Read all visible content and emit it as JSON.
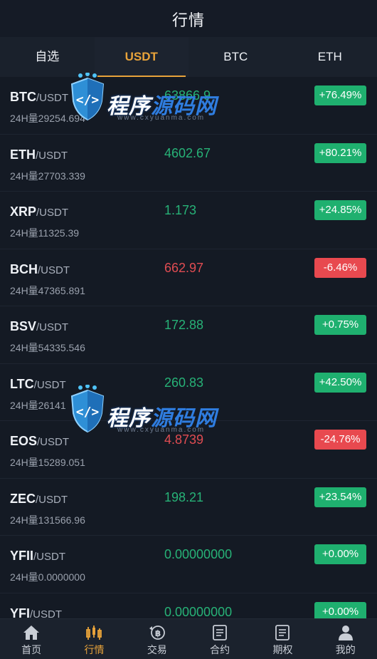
{
  "header": {
    "title": "行情"
  },
  "tabs": [
    {
      "label": "自选"
    },
    {
      "label": "USDT"
    },
    {
      "label": "BTC"
    },
    {
      "label": "ETH"
    }
  ],
  "colors": {
    "accent": "#e8a33a",
    "up": "#27b277",
    "down": "#e04c52",
    "background": "#141a24"
  },
  "markets": [
    {
      "base": "BTC",
      "quote": "/USDT",
      "volume": "24H量29254.694",
      "price": "63866.9",
      "change": "+76.49%",
      "dir": "up"
    },
    {
      "base": "ETH",
      "quote": "/USDT",
      "volume": "24H量27703.339",
      "price": "4602.67",
      "change": "+80.21%",
      "dir": "up"
    },
    {
      "base": "XRP",
      "quote": "/USDT",
      "volume": "24H量11325.39",
      "price": "1.173",
      "change": "+24.85%",
      "dir": "up"
    },
    {
      "base": "BCH",
      "quote": "/USDT",
      "volume": "24H量47365.891",
      "price": "662.97",
      "change": "-6.46%",
      "dir": "down"
    },
    {
      "base": "BSV",
      "quote": "/USDT",
      "volume": "24H量54335.546",
      "price": "172.88",
      "change": "+0.75%",
      "dir": "up"
    },
    {
      "base": "LTC",
      "quote": "/USDT",
      "volume": "24H量26141",
      "price": "260.83",
      "change": "+42.50%",
      "dir": "up"
    },
    {
      "base": "EOS",
      "quote": "/USDT",
      "volume": "24H量15289.051",
      "price": "4.8739",
      "change": "-24.76%",
      "dir": "down"
    },
    {
      "base": "ZEC",
      "quote": "/USDT",
      "volume": "24H量131566.96",
      "price": "198.21",
      "change": "+23.54%",
      "dir": "up"
    },
    {
      "base": "YFII",
      "quote": "/USDT",
      "volume": "24H量0.0000000",
      "price": "0.00000000",
      "change": "+0.00%",
      "dir": "up"
    },
    {
      "base": "YFI",
      "quote": "/USDT",
      "volume": "",
      "price": "0.00000000",
      "change": "+0.00%",
      "dir": "up"
    }
  ],
  "watermark": {
    "text_white": "程序",
    "text_blue": "源码网",
    "sub": "www.cxyuanma.com"
  },
  "nav": [
    {
      "label": "首页",
      "icon": "home-icon"
    },
    {
      "label": "行情",
      "icon": "candlestick-icon"
    },
    {
      "label": "交易",
      "icon": "bitcoin-exchange-icon"
    },
    {
      "label": "合约",
      "icon": "contract-document-icon"
    },
    {
      "label": "期权",
      "icon": "options-document-icon"
    },
    {
      "label": "我的",
      "icon": "user-icon"
    }
  ]
}
